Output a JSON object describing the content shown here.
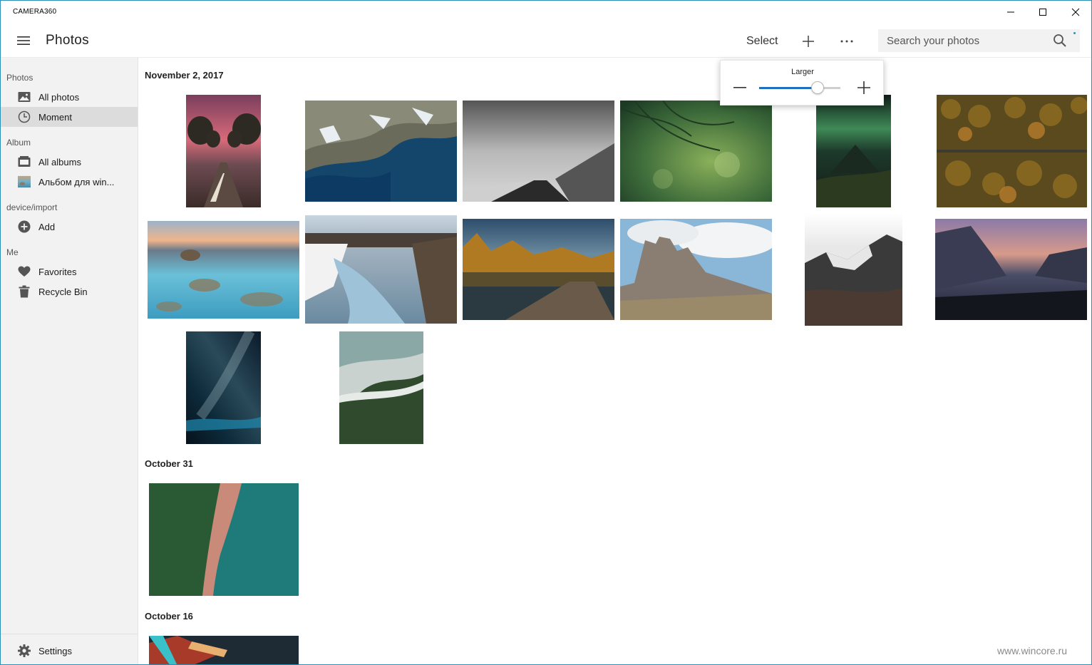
{
  "window": {
    "title": "CAMERA360"
  },
  "header": {
    "page_title": "Photos",
    "select_label": "Select",
    "search_placeholder": "Search your photos",
    "icons": {
      "menu": "hamburger-icon",
      "add": "plus-icon",
      "more": "more-icon",
      "search": "search-icon"
    }
  },
  "sidebar": {
    "sections": [
      {
        "label": "Photos",
        "items": [
          {
            "label": "All photos",
            "icon": "image-icon"
          },
          {
            "label": "Moment",
            "icon": "clock-icon",
            "active": true
          }
        ]
      },
      {
        "label": "Album",
        "items": [
          {
            "label": "All albums",
            "icon": "album-icon"
          },
          {
            "label": "Альбом для win...",
            "icon": "album-thumbnail"
          }
        ]
      },
      {
        "label": "device/import",
        "items": [
          {
            "label": "Add",
            "icon": "add-circle-icon"
          }
        ]
      },
      {
        "label": "Me",
        "items": [
          {
            "label": "Favorites",
            "icon": "heart-icon"
          },
          {
            "label": "Recycle Bin",
            "icon": "trash-icon"
          }
        ]
      }
    ],
    "settings_label": "Settings"
  },
  "groups": [
    {
      "date": "November 2, 2017"
    },
    {
      "date": "October 31"
    },
    {
      "date": "October 16"
    }
  ],
  "zoom_popup": {
    "label": "Larger",
    "value": 0.72
  },
  "colors": {
    "accent": "#1f6fc2",
    "border": "#2d8fb6",
    "sidebar_bg": "#f2f2f2",
    "active_item": "#dcdcdc"
  },
  "watermark": "www.wincore.ru"
}
